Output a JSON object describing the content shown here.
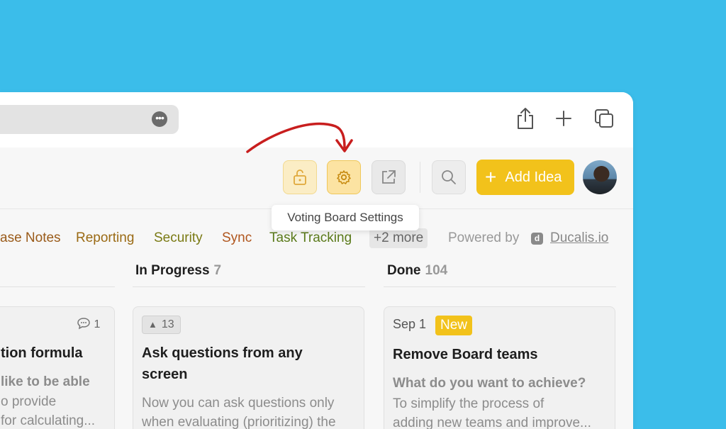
{
  "tooltip": "Voting Board Settings",
  "toolbar": {
    "add_idea_label": "Add Idea",
    "add_idea_icon": "plus-icon"
  },
  "colors": {
    "background": "#3bbdea",
    "accent_yellow": "#f2c21b",
    "arrow_red": "#c81e1e"
  },
  "tags": [
    {
      "label": "ase Notes",
      "color": "#9a5b1a"
    },
    {
      "label": "Reporting",
      "color": "#9a6a14"
    },
    {
      "label": "Security",
      "color": "#7a7a14"
    },
    {
      "label": "Sync",
      "color": "#b0561e"
    },
    {
      "label": "Task Tracking",
      "color": "#5a7a1a"
    }
  ],
  "tags_more": "+2 more",
  "powered": {
    "text": "Powered by",
    "logo_letter": "d",
    "link": "Ducalis.io"
  },
  "columns": [
    {
      "title": "In Progress",
      "count": "7",
      "card": {
        "votes": "13",
        "title_line1": "Ask questions from any",
        "title_line2": "screen",
        "text_line1": "Now you can ask questions only",
        "text_line2": "when evaluating (prioritizing) the"
      }
    },
    {
      "title": "Done",
      "count": "104",
      "card": {
        "date": "Sep 1",
        "badge": "New",
        "title": "Remove Board teams",
        "question": "What do you want to achieve?",
        "text_line1": "To simplify the process of",
        "text_line2": "adding new teams and improve..."
      }
    }
  ],
  "partial_card": {
    "comments": "1",
    "title": "tion formula",
    "question": "like to be able",
    "text_line1": "o provide",
    "text_line2": "for calculating..."
  }
}
